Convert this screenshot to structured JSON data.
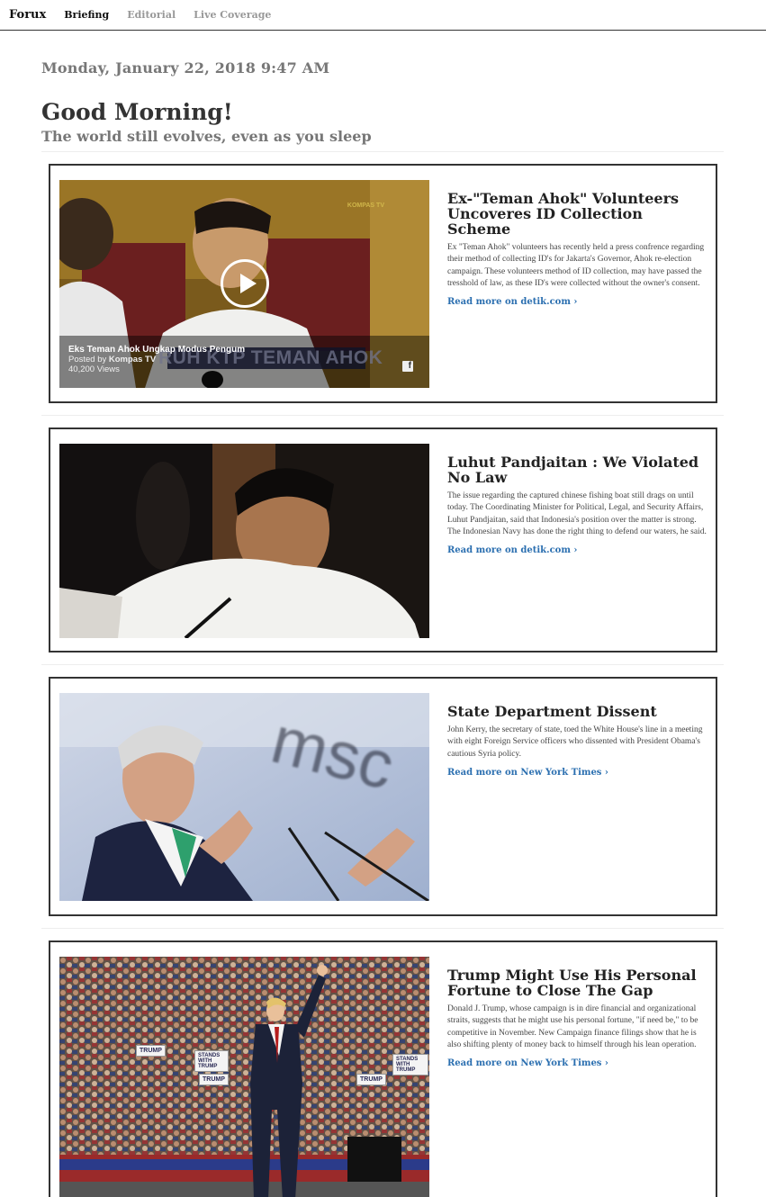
{
  "nav": {
    "brand": "Forux",
    "links": [
      "Briefing",
      "Editorial",
      "Live Coverage"
    ]
  },
  "header": {
    "date": "Monday, January 22, 2018 9:47 AM",
    "greeting": "Good Morning!",
    "subtitle": "The world still evolves, even as you sleep"
  },
  "articles": [
    {
      "headline": "Ex-\"Teman Ahok\" Volunteers Uncoveres ID Collection Scheme",
      "body": "Ex \"Teman Ahok\" volunteers has recently held a press confrence regarding their method of collecting ID's for Jakarta's Governor, Ahok re-election campaign. These volunteers method of ID collection, may have passed the tresshold of law, as these ID's were collected without the owner's consent.",
      "read_more": "Read more on detik.com",
      "video": {
        "title": "Eks Teman Ahok Ungkap Modus Pengum",
        "posted_prefix": "Posted by",
        "posted_by": "Kompas TV",
        "views": "40,200 Views",
        "banner": "RUH KTP TEMAN AHOK",
        "logo": "KOMPAS TV",
        "fb": "f"
      }
    },
    {
      "headline": "Luhut Pandjaitan : We Violated No Law",
      "body": "The issue regarding the captured chinese fishing boat still drags on until today. The Coordinating Minister for Political, Legal, and Security Affairs, Luhut Pandjaitan, said that Indonesia's position over the matter is strong. The Indonesian Navy has done the right thing to defend our waters, he said.",
      "read_more": "Read more on detik.com"
    },
    {
      "headline": "State Department Dissent",
      "body": "John Kerry, the secretary of state, toed the White House's line in a meeting with eight Foreign Service officers who dissented with President Obama's cautious Syria policy.",
      "read_more": "Read more on New York Times",
      "photo_text": "msc"
    },
    {
      "headline": "Trump Might Use His Personal Fortune to Close The Gap",
      "body": "Donald J. Trump, whose campaign is in dire financial and organizational straits, suggests that he might use his personal fortune, \"if need be,\" to be competitive in November. New Campaign finance filings show that he is also shifting plenty of money back to himself through his lean operation.",
      "read_more": "Read more on New York Times",
      "signs": [
        "TRUMP",
        "STANDS WITH TRUMP",
        "TRUMP",
        "STANDS WITH TRUMP",
        "TRUMP"
      ]
    }
  ],
  "colors": {
    "link": "#2b6fb0",
    "border": "#333333"
  }
}
